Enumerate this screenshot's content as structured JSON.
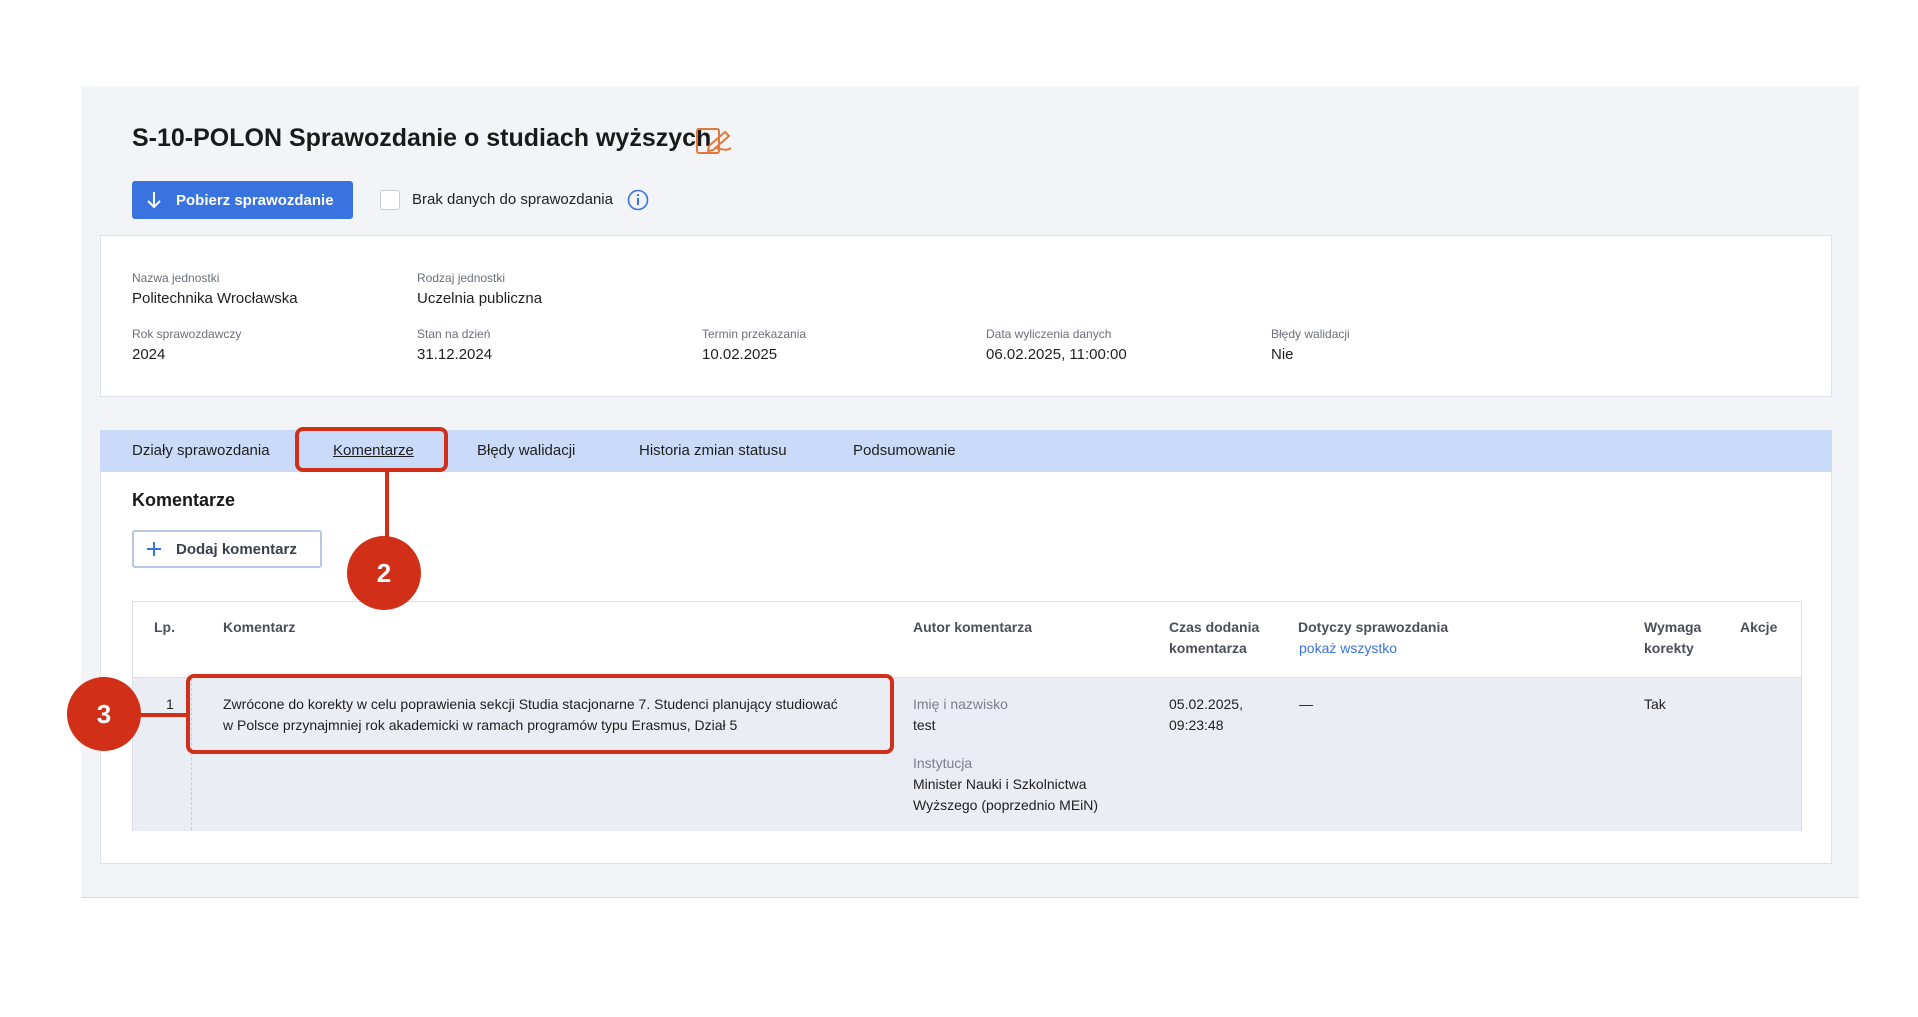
{
  "header": {
    "title": "S-10-POLON Sprawozdanie o studiach wyższych",
    "download_button": "Pobierz sprawozdanie",
    "no_data_checkbox_label": "Brak danych do sprawozdania"
  },
  "info": {
    "unit_name_label": "Nazwa jednostki",
    "unit_name": "Politechnika Wrocławska",
    "unit_type_label": "Rodzaj jednostki",
    "unit_type": "Uczelnia publiczna",
    "year_label": "Rok sprawozdawczy",
    "year": "2024",
    "state_label": "Stan na dzień",
    "state": "31.12.2024",
    "deadline_label": "Termin przekazania",
    "deadline": "10.02.2025",
    "calc_label": "Data wyliczenia danych",
    "calc": "06.02.2025, 11:00:00",
    "errors_label": "Błędy walidacji",
    "errors": "Nie"
  },
  "tabs": [
    "Działy sprawozdania",
    "Komentarze",
    "Błędy walidacji",
    "Historia zmian statusu",
    "Podsumowanie"
  ],
  "active_tab": "Komentarze",
  "comments": {
    "title": "Komentarze",
    "add_button": "Dodaj komentarz",
    "columns": {
      "lp": "Lp.",
      "comment": "Komentarz",
      "author": "Autor komentarza",
      "time_1": "Czas dodania",
      "time_2": "komentarza",
      "report": "Dotyczy sprawozdania",
      "show_all": "pokaż wszystko",
      "correction_1": "Wymaga",
      "correction_2": "korekty",
      "actions": "Akcje"
    },
    "rows": [
      {
        "lp": "1",
        "text_line1": "Zwrócone do korekty w celu poprawienia sekcji Studia stacjonarne 7. Studenci planujący studiować",
        "text_line2": "w Polsce przynajmniej rok akademicki w ramach programów typu Erasmus, Dział 5",
        "author_name_label": "Imię i nazwisko",
        "author_name": "test",
        "author_inst_label": "Instytucja",
        "author_inst_line1": "Minister Nauki i Szkolnictwa",
        "author_inst_line2": "Wyższego (poprzednio MEiN)",
        "date": "05.02.2025,",
        "time": "09:23:48",
        "report": "—",
        "requires_correction": "Tak"
      }
    ]
  },
  "annotations": {
    "badge_2": "2",
    "badge_3": "3"
  },
  "colors": {
    "primary": "#3873e0",
    "tab_bar": "#c9dbf8",
    "callout": "#d12f17",
    "edit_icon": "#e07a3c"
  }
}
